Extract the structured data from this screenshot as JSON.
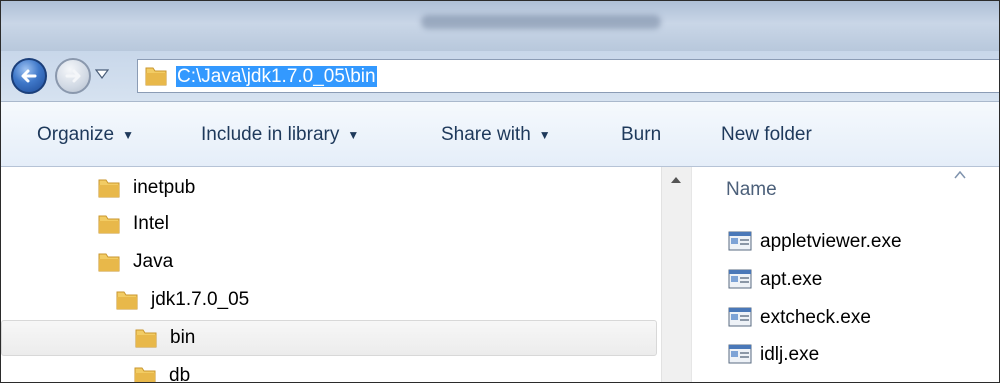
{
  "address": {
    "path": "C:\\Java\\jdk1.7.0_05\\bin"
  },
  "toolbar": {
    "organize": "Organize",
    "include_in_library": "Include in library",
    "share_with": "Share with",
    "burn": "Burn",
    "new_folder": "New folder"
  },
  "nav_tree": {
    "items": [
      {
        "label": "inetpub"
      },
      {
        "label": "Intel"
      },
      {
        "label": "Java"
      },
      {
        "label": "jdk1.7.0_05"
      },
      {
        "label": "bin",
        "selected": true
      },
      {
        "label": "db"
      }
    ]
  },
  "content": {
    "column_header": "Name",
    "files": [
      {
        "name": "appletviewer.exe"
      },
      {
        "name": "apt.exe"
      },
      {
        "name": "extcheck.exe"
      },
      {
        "name": "idlj.exe"
      }
    ]
  },
  "colors": {
    "selection": "#3399ff",
    "command_text": "#1e395b",
    "folder": "#e8b84a"
  },
  "icons": [
    "back-arrow-icon",
    "forward-arrow-icon",
    "dropdown-icon",
    "folder-icon",
    "exe-icon",
    "scroll-up-icon",
    "sort-arrow-icon"
  ]
}
